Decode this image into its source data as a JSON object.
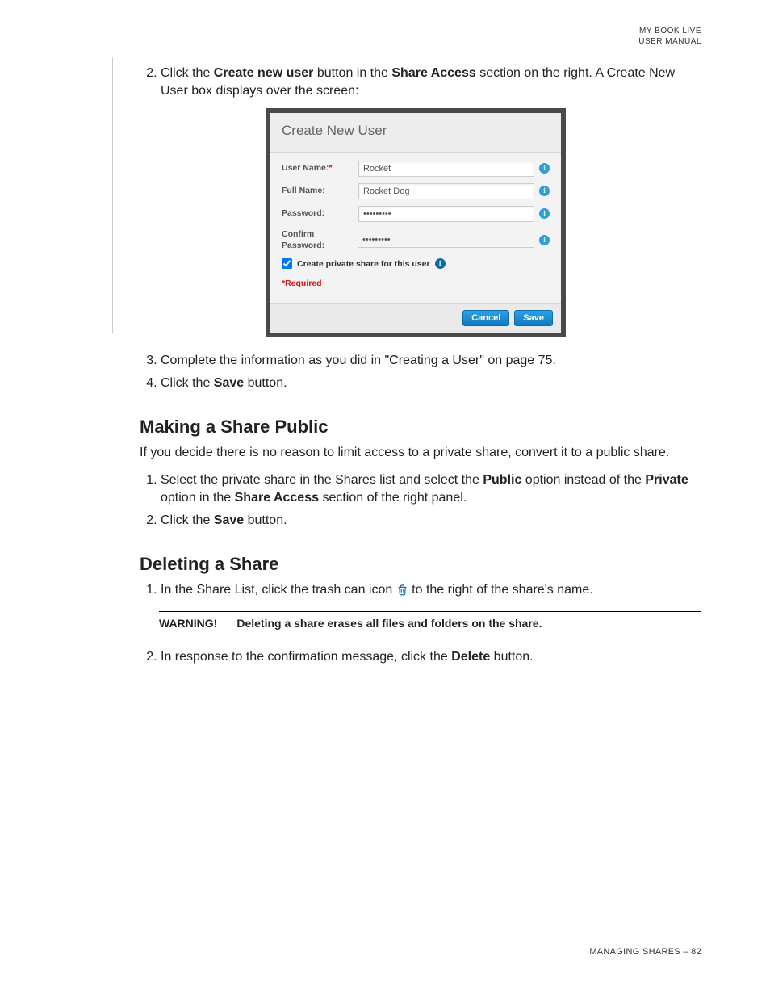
{
  "header": {
    "line1": "MY BOOK LIVE",
    "line2": "USER MANUAL"
  },
  "step2": {
    "num": "2.",
    "pre": "Click the ",
    "bold1": "Create new user",
    "mid1": " button in the ",
    "bold2": "Share Access",
    "post": " section on the right. A Create New User box displays over the screen:"
  },
  "dialog": {
    "title": "Create New User",
    "rows": {
      "username": {
        "label": "User Name:",
        "req": "*",
        "value": "Rocket"
      },
      "fullname": {
        "label": "Full Name:",
        "value": "Rocket Dog"
      },
      "password": {
        "label": "Password:",
        "value": "•••••••••"
      },
      "confirm": {
        "label": "Confirm Password:",
        "value": "•••••••••"
      }
    },
    "checkbox_label": "Create private share for this user",
    "required_note": "*Required",
    "cancel": "Cancel",
    "save": "Save"
  },
  "step3": {
    "num": "3.",
    "text": "Complete the information as you did in \"Creating a User\" on page 75."
  },
  "step4": {
    "num": "4.",
    "pre": "Click the ",
    "bold": "Save",
    "post": " button."
  },
  "section_public": {
    "title": "Making a Share Public",
    "intro": "If you decide there is no reason to limit access to a private share, convert it to a public share.",
    "s1": {
      "num": "1.",
      "pre": "Select the private share in the Shares list and select the ",
      "bold1": "Public",
      "mid1": " option instead of the ",
      "bold2": "Private",
      "mid2": " option in the ",
      "bold3": "Share Access",
      "post": " section of the right panel."
    },
    "s2": {
      "num": "2.",
      "pre": "Click the ",
      "bold": "Save",
      "post": " button."
    }
  },
  "section_delete": {
    "title": "Deleting a Share",
    "s1": {
      "num": "1.",
      "pre": "In the Share List, click the trash can icon ",
      "post": " to the right of the share's name."
    },
    "warning_label": "WARNING!",
    "warning_text": "Deleting a share erases all files and folders on the share.",
    "s2": {
      "num": "2.",
      "pre": "In response to the confirmation message, click the ",
      "bold": "Delete",
      "post": " button."
    }
  },
  "footer": {
    "section": "MANAGING SHARES",
    "sep": " – ",
    "page": "82"
  },
  "info_glyph": "i"
}
